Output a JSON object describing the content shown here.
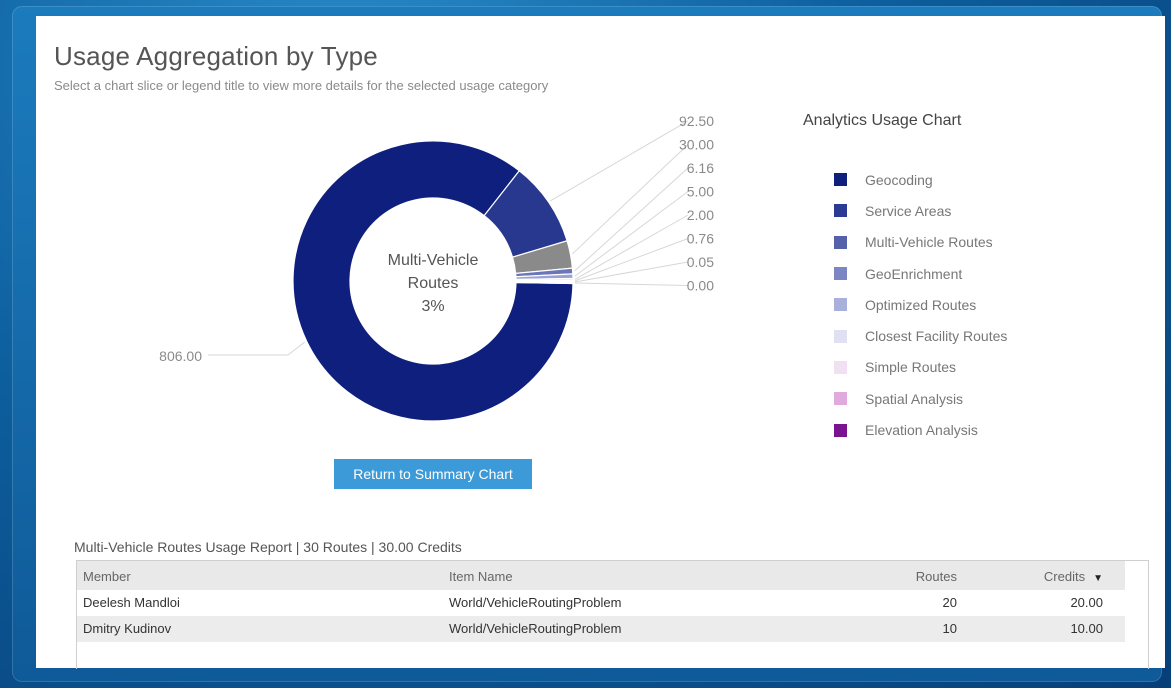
{
  "page": {
    "title": "Usage Aggregation by Type",
    "subtitle": "Select a chart slice or legend title to view more details for the selected usage category"
  },
  "chart_data": {
    "type": "pie",
    "categories": [
      "Geocoding",
      "Service Areas",
      "Multi-Vehicle Routes",
      "GeoEnrichment",
      "Optimized Routes",
      "Closest Facility Routes",
      "Simple Routes",
      "Spatial Analysis",
      "Elevation Analysis"
    ],
    "values": [
      806.0,
      92.5,
      30.0,
      6.16,
      5.0,
      2.0,
      0.76,
      0.05,
      0.0
    ],
    "value_labels": [
      "806.00",
      "92.50",
      "30.00",
      "6.16",
      "5.00",
      "2.00",
      "0.76",
      "0.05",
      "0.00"
    ],
    "colors": [
      "#0f1f7e",
      "#29388f",
      "#8a8a8a",
      "#6b76b8",
      "#9aa3d4",
      "#d9dcf0",
      "#efe1f1",
      "#d9a9d6",
      "#7a1390"
    ],
    "selected_category": "Multi-Vehicle Routes",
    "center_label": [
      "Multi-Vehicle",
      "Routes",
      "3%"
    ],
    "legend_placement": "right",
    "legend_title": "Analytics Usage Chart"
  },
  "legend": {
    "title": "Analytics Usage Chart",
    "items": [
      {
        "label": "Geocoding",
        "color": "#0f1f7e"
      },
      {
        "label": "Service Areas",
        "color": "#2b3a92"
      },
      {
        "label": "Multi-Vehicle Routes",
        "color": "#5561a8"
      },
      {
        "label": "GeoEnrichment",
        "color": "#7c86c4"
      },
      {
        "label": "Optimized Routes",
        "color": "#a9b0dc"
      },
      {
        "label": "Closest Facility Routes",
        "color": "#dfe1f2"
      },
      {
        "label": "Simple Routes",
        "color": "#f1e0f2"
      },
      {
        "label": "Spatial Analysis",
        "color": "#e1aadf"
      },
      {
        "label": "Elevation Analysis",
        "color": "#7a1390"
      }
    ]
  },
  "actions": {
    "return_label": "Return to Summary Chart"
  },
  "report": {
    "title": "Multi-Vehicle Routes Usage Report | 30 Routes | 30.00 Credits",
    "columns": {
      "member": "Member",
      "item": "Item Name",
      "routes": "Routes",
      "credits": "Credits"
    },
    "sort_icon": "sort-descending-icon",
    "rows": [
      {
        "member": "Deelesh Mandloi",
        "item": "World/VehicleRoutingProblem",
        "routes": "20",
        "credits": "20.00"
      },
      {
        "member": "Dmitry Kudinov",
        "item": "World/VehicleRoutingProblem",
        "routes": "10",
        "credits": "10.00"
      }
    ]
  }
}
